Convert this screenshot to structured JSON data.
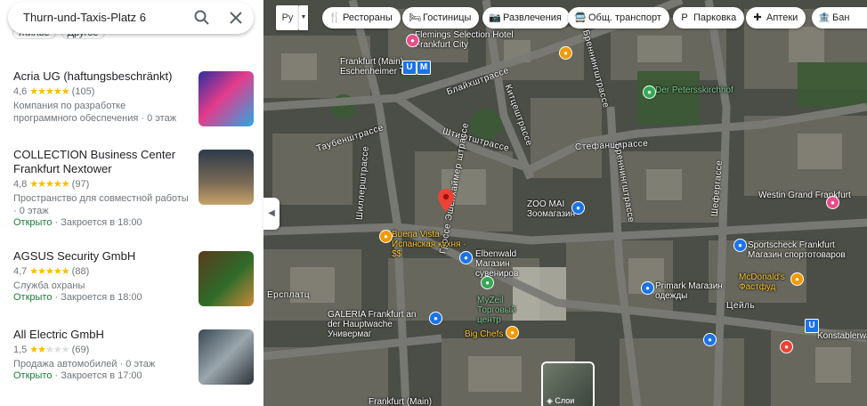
{
  "search": {
    "query": "Thurn-und-Taxis-Platz 6"
  },
  "filter_chips": [
    "Жилье",
    "Другое"
  ],
  "results": [
    {
      "name": "Acria UG (haftungsbeschränkt)",
      "rating": "4,6",
      "stars": 4.5,
      "reviews": "(105)",
      "desc": "Компания по разработке программного обеспечения · 0 этаж",
      "open": "",
      "hours": ""
    },
    {
      "name": "COLLECTION Business Center Frankfurt Nextower",
      "rating": "4,8",
      "stars": 5,
      "reviews": "(97)",
      "desc": "Пространство для совместной работы · 0 этаж",
      "open": "Открыто",
      "hours": " · Закроется в 18:00"
    },
    {
      "name": "AGSUS Security GmbH",
      "rating": "4,7",
      "stars": 4.5,
      "reviews": "(88)",
      "desc": "Служба охраны",
      "open": "Открыто",
      "hours": " · Закроется в 18:00"
    },
    {
      "name": "All Electric GmbH",
      "rating": "1,5",
      "stars": 1.5,
      "reviews": "(69)",
      "desc": "Продажа автомобилей · 0 этаж",
      "open": "Открыто",
      "hours": " · Закроется в 17:00"
    }
  ],
  "map_chips": [
    {
      "icon": "fork-knife-icon",
      "glyph": "🍴",
      "label": "Рестораны"
    },
    {
      "icon": "bed-icon",
      "glyph": "🛏",
      "label": "Гостиницы"
    },
    {
      "icon": "camera-icon",
      "glyph": "📷",
      "label": "Развлечения"
    },
    {
      "icon": "bus-icon",
      "glyph": "🚍",
      "label": "Общ. транспорт"
    },
    {
      "icon": "parking-icon",
      "glyph": "P",
      "label": "Парковка"
    },
    {
      "icon": "pharmacy-icon",
      "glyph": "✚",
      "label": "Аптеки"
    },
    {
      "icon": "bank-icon",
      "glyph": "🏦",
      "label": "Бан"
    }
  ],
  "map": {
    "top_toggle": "Ру",
    "layers_label": "Слои",
    "places": [
      {
        "name": "Flemings Selection Hotel Frankfurt City"
      },
      {
        "name": "Frankfurt (Main) Eschenheimer Tor"
      },
      {
        "name": "Der Petersskirchhof"
      },
      {
        "name": "Westin Grand Frankfurt"
      },
      {
        "name": "Sportscheck Frankfurt Магазин спортотоваров"
      },
      {
        "name": "McDonald's Фастфуд"
      },
      {
        "name": "Primark Магазин одежды"
      },
      {
        "name": "Konstablerwache"
      },
      {
        "name": "ZOO MAI Зоомагазин"
      },
      {
        "name": "Buena Vista Испанская кухня · $$"
      },
      {
        "name": "Elbenwald Магазин сувениров"
      },
      {
        "name": "MyZeil Торговый центр"
      },
      {
        "name": "GALERIA Frankfurt an der Hauptwache Универмаг"
      },
      {
        "name": "Big Chefs"
      },
      {
        "name": "Frankfurt (Main)"
      }
    ],
    "streets": [
      "Блайхштрассе",
      "Бреннингштрассе",
      "Таубенштрассе",
      "Китцештрассе",
      "Штифтштрассе",
      "Гроссе Эшенхаймер штрассе",
      "Шиллерштрассе",
      "Стефанштрассе",
      "Бреннингштрассе",
      "Шефергассе",
      "Ерсплатц",
      "Цейль"
    ]
  },
  "colors": {
    "star": "#fbbc04",
    "open": "#188038",
    "link": "#1a73e8",
    "pin": "#ea4335"
  }
}
